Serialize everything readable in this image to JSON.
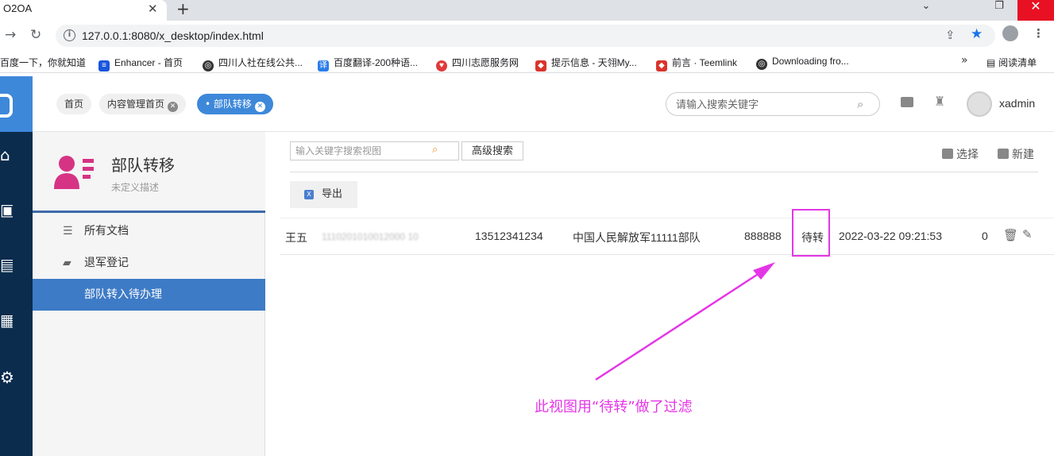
{
  "browser": {
    "tab_title": "O2OA",
    "tab_close": "✕",
    "new_tab": "+",
    "url": "127.0.0.1:8080/x_desktop/index.html",
    "window": {
      "minimize": "⌄",
      "restore": "❐",
      "close": "✕"
    },
    "bookmarks": [
      {
        "label": "百度一下，你就知道",
        "icon": "",
        "color": ""
      },
      {
        "label": "Enhancer - 首页",
        "icon": "list-icon",
        "color": "#1a56db"
      },
      {
        "label": "四川人社在线公共...",
        "icon": "globe-icon",
        "color": "#333333"
      },
      {
        "label": "百度翻译-200种语...",
        "icon": "translate-icon",
        "color": "#2b7de9"
      },
      {
        "label": "四川志愿服务网",
        "icon": "volunteer-icon",
        "color": "#e03a3a"
      },
      {
        "label": "提示信息 - 天翎My...",
        "icon": "tianling-icon",
        "color": "#d9342b"
      },
      {
        "label": "前言 · Teemlink",
        "icon": "teemlink-icon",
        "color": "#d9342b"
      },
      {
        "label": "Downloading fro...",
        "icon": "globe-icon",
        "color": "#333333"
      }
    ],
    "more": "»",
    "reading_list": "阅读清单"
  },
  "breadcrumbs": [
    {
      "label": "首页",
      "closable": false,
      "active": false
    },
    {
      "label": "内容管理首页",
      "closable": true,
      "active": false
    },
    {
      "label": "• 部队转移",
      "closable": true,
      "active": true
    }
  ],
  "header": {
    "search_placeholder": "请输入搜索关键字",
    "username": "xadmin"
  },
  "app": {
    "title": "部队转移",
    "description": "未定义描述",
    "nav": [
      {
        "label": "所有文档",
        "icon": "list-icon",
        "active": false
      },
      {
        "label": "退军登记",
        "icon": "folder-icon",
        "active": false
      },
      {
        "label": "部队转入待办理",
        "icon": "",
        "active": true
      }
    ]
  },
  "view": {
    "search_placeholder": "输入关键字搜索视图",
    "advanced_search": "高级搜索",
    "select": "选择",
    "new": "新建",
    "export": "导出",
    "rows": [
      {
        "name": "王五",
        "id_masked": "1110201010012000 10",
        "phone": "13512341234",
        "unit": "中国人民解放军11111部队",
        "code": "888888",
        "status": "待转",
        "datetime": "2022-03-22 09:21:53",
        "count": "0"
      }
    ]
  },
  "annotation": {
    "text": "此视图用“待转”做了过滤",
    "color": "#e436e6"
  },
  "colors": {
    "accent": "#3e88da",
    "nav_dark": "#0b2c4d",
    "side_active": "#3e7bc6",
    "app_icon": "#d63384"
  }
}
